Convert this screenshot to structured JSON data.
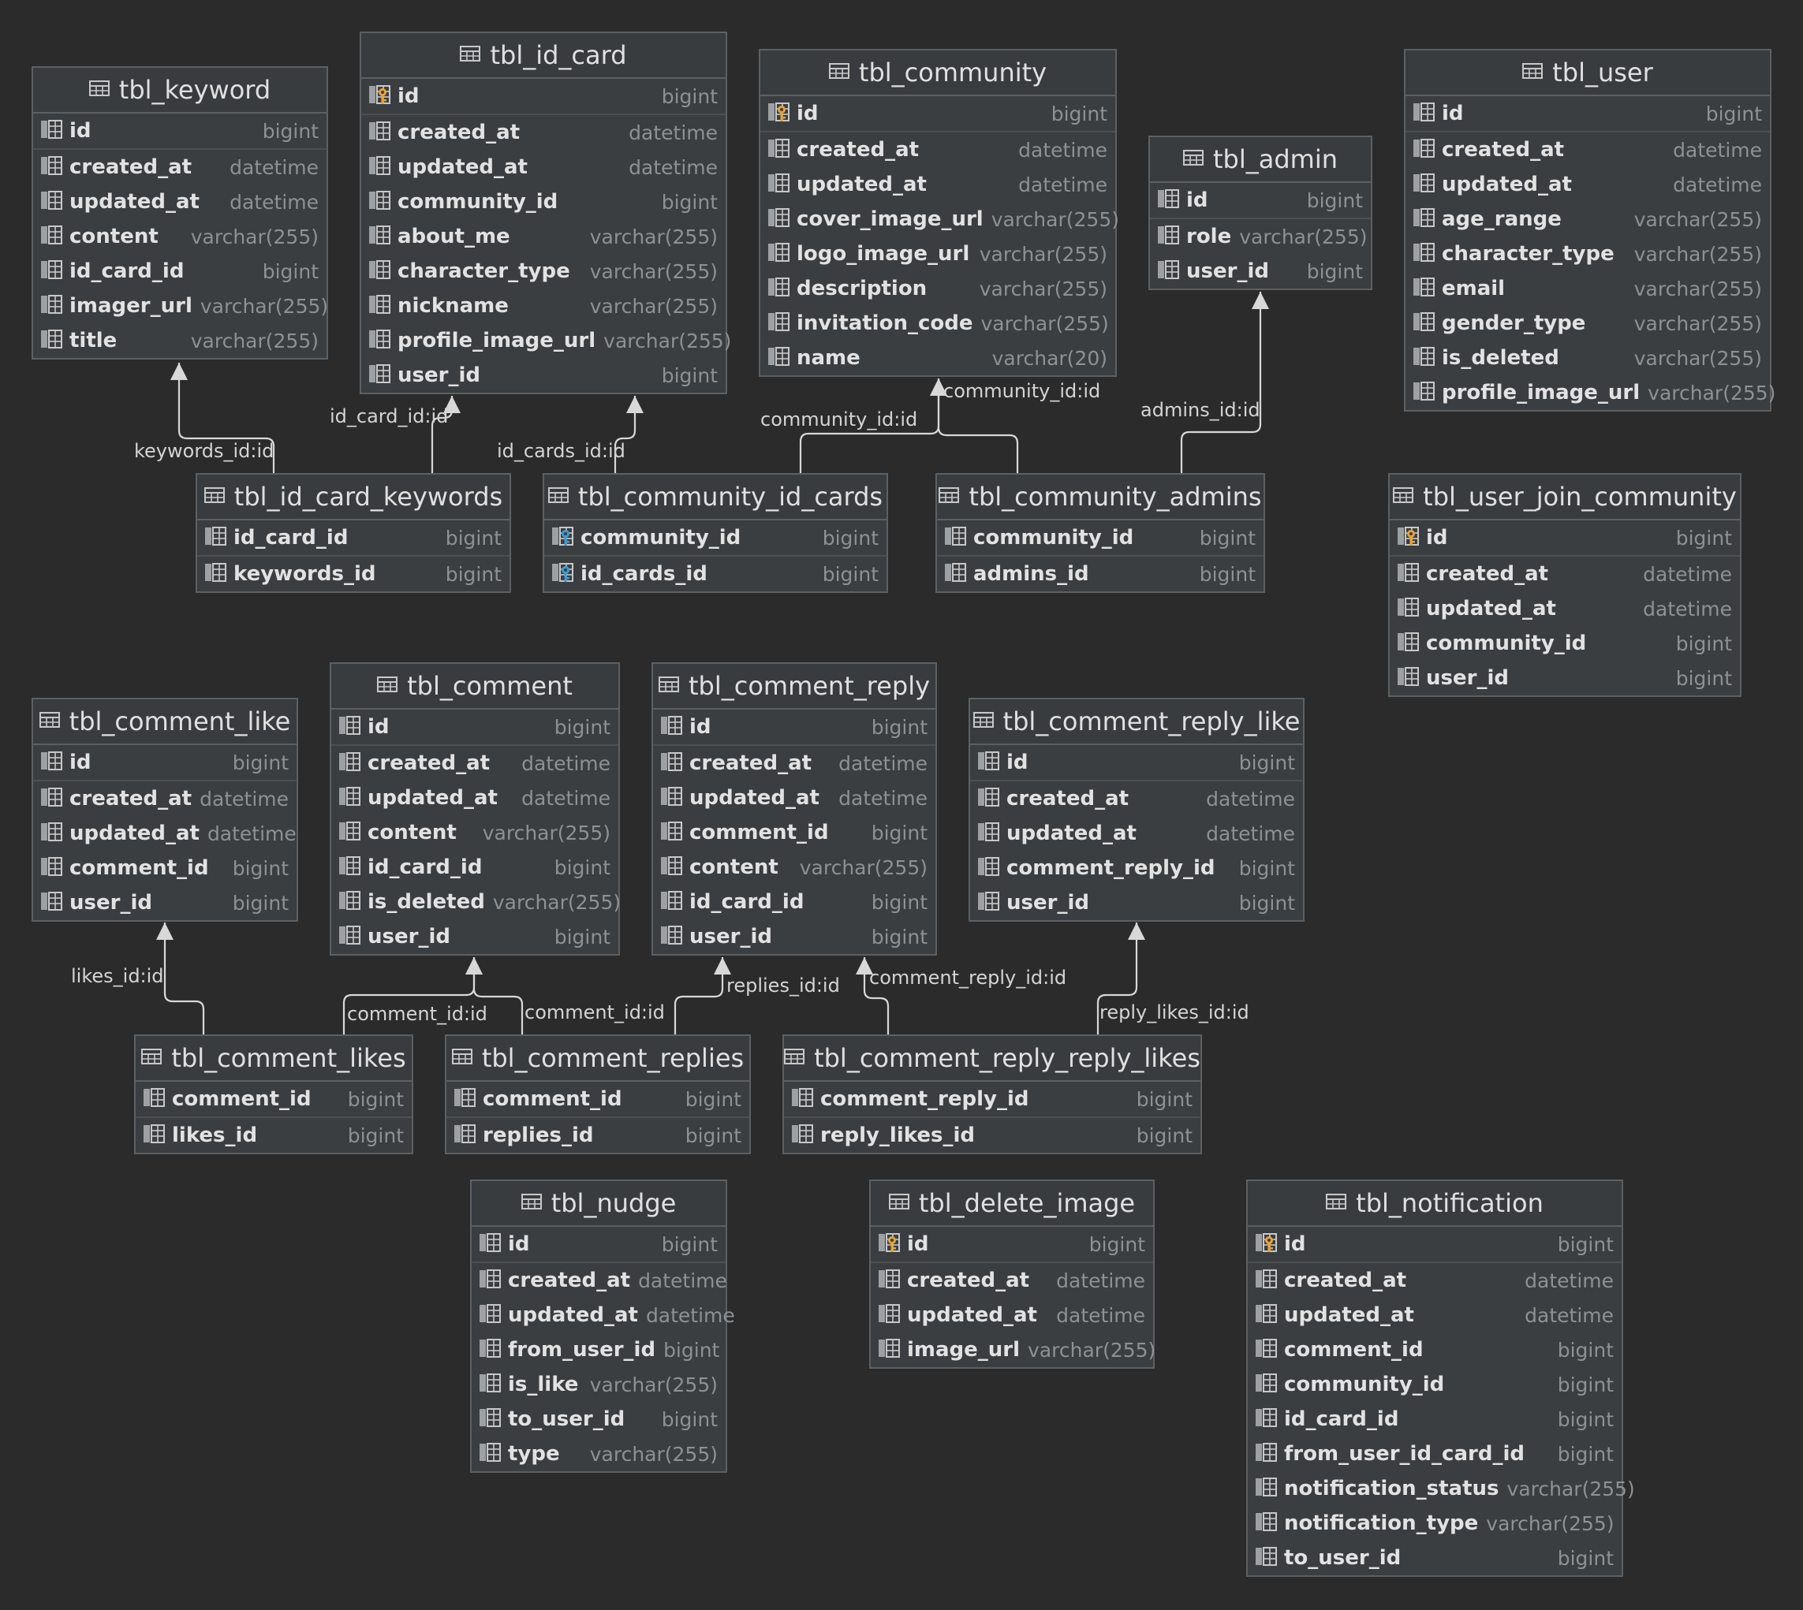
{
  "tables": [
    {
      "name": "tbl_keyword",
      "columns": [
        {
          "name": "id",
          "type": "bigint",
          "icon": "column-icon"
        },
        {
          "name": "created_at",
          "type": "datetime",
          "icon": "column-icon"
        },
        {
          "name": "updated_at",
          "type": "datetime",
          "icon": "column-icon"
        },
        {
          "name": "content",
          "type": "varchar(255)",
          "icon": "column-icon"
        },
        {
          "name": "id_card_id",
          "type": "bigint",
          "icon": "column-icon"
        },
        {
          "name": "imager_url",
          "type": "varchar(255)",
          "icon": "column-icon"
        },
        {
          "name": "title",
          "type": "varchar(255)",
          "icon": "column-icon"
        }
      ]
    },
    {
      "name": "tbl_id_card",
      "columns": [
        {
          "name": "id",
          "type": "bigint",
          "icon": "primary-key-icon"
        },
        {
          "name": "created_at",
          "type": "datetime",
          "icon": "column-icon"
        },
        {
          "name": "updated_at",
          "type": "datetime",
          "icon": "column-icon"
        },
        {
          "name": "community_id",
          "type": "bigint",
          "icon": "column-icon"
        },
        {
          "name": "about_me",
          "type": "varchar(255)",
          "icon": "column-icon"
        },
        {
          "name": "character_type",
          "type": "varchar(255)",
          "icon": "column-icon"
        },
        {
          "name": "nickname",
          "type": "varchar(255)",
          "icon": "column-icon"
        },
        {
          "name": "profile_image_url",
          "type": "varchar(255)",
          "icon": "column-icon"
        },
        {
          "name": "user_id",
          "type": "bigint",
          "icon": "column-icon"
        }
      ]
    },
    {
      "name": "tbl_community",
      "columns": [
        {
          "name": "id",
          "type": "bigint",
          "icon": "primary-key-icon"
        },
        {
          "name": "created_at",
          "type": "datetime",
          "icon": "column-icon"
        },
        {
          "name": "updated_at",
          "type": "datetime",
          "icon": "column-icon"
        },
        {
          "name": "cover_image_url",
          "type": "varchar(255)",
          "icon": "column-icon"
        },
        {
          "name": "logo_image_url",
          "type": "varchar(255)",
          "icon": "column-icon"
        },
        {
          "name": "description",
          "type": "varchar(255)",
          "icon": "column-icon"
        },
        {
          "name": "invitation_code",
          "type": "varchar(255)",
          "icon": "column-icon"
        },
        {
          "name": "name",
          "type": "varchar(20)",
          "icon": "column-icon"
        }
      ]
    },
    {
      "name": "tbl_admin",
      "columns": [
        {
          "name": "id",
          "type": "bigint",
          "icon": "column-icon"
        },
        {
          "name": "role",
          "type": "varchar(255)",
          "icon": "column-icon"
        },
        {
          "name": "user_id",
          "type": "bigint",
          "icon": "column-icon"
        }
      ]
    },
    {
      "name": "tbl_user",
      "columns": [
        {
          "name": "id",
          "type": "bigint",
          "icon": "column-icon"
        },
        {
          "name": "created_at",
          "type": "datetime",
          "icon": "column-icon"
        },
        {
          "name": "updated_at",
          "type": "datetime",
          "icon": "column-icon"
        },
        {
          "name": "age_range",
          "type": "varchar(255)",
          "icon": "column-icon"
        },
        {
          "name": "character_type",
          "type": "varchar(255)",
          "icon": "column-icon"
        },
        {
          "name": "email",
          "type": "varchar(255)",
          "icon": "column-icon"
        },
        {
          "name": "gender_type",
          "type": "varchar(255)",
          "icon": "column-icon"
        },
        {
          "name": "is_deleted",
          "type": "varchar(255)",
          "icon": "column-icon"
        },
        {
          "name": "profile_image_url",
          "type": "varchar(255)",
          "icon": "column-icon"
        }
      ]
    },
    {
      "name": "tbl_id_card_keywords",
      "columns": [
        {
          "name": "id_card_id",
          "type": "bigint",
          "icon": "column-icon"
        },
        {
          "name": "keywords_id",
          "type": "bigint",
          "icon": "column-icon"
        }
      ]
    },
    {
      "name": "tbl_community_id_cards",
      "columns": [
        {
          "name": "community_id",
          "type": "bigint",
          "icon": "composite-key-icon"
        },
        {
          "name": "id_cards_id",
          "type": "bigint",
          "icon": "composite-key-icon"
        }
      ]
    },
    {
      "name": "tbl_community_admins",
      "columns": [
        {
          "name": "community_id",
          "type": "bigint",
          "icon": "column-icon"
        },
        {
          "name": "admins_id",
          "type": "bigint",
          "icon": "column-icon"
        }
      ]
    },
    {
      "name": "tbl_user_join_community",
      "columns": [
        {
          "name": "id",
          "type": "bigint",
          "icon": "primary-key-icon"
        },
        {
          "name": "created_at",
          "type": "datetime",
          "icon": "column-icon"
        },
        {
          "name": "updated_at",
          "type": "datetime",
          "icon": "column-icon"
        },
        {
          "name": "community_id",
          "type": "bigint",
          "icon": "column-icon"
        },
        {
          "name": "user_id",
          "type": "bigint",
          "icon": "column-icon"
        }
      ]
    },
    {
      "name": "tbl_comment_like",
      "columns": [
        {
          "name": "id",
          "type": "bigint",
          "icon": "column-icon"
        },
        {
          "name": "created_at",
          "type": "datetime",
          "icon": "column-icon"
        },
        {
          "name": "updated_at",
          "type": "datetime",
          "icon": "column-icon"
        },
        {
          "name": "comment_id",
          "type": "bigint",
          "icon": "column-icon"
        },
        {
          "name": "user_id",
          "type": "bigint",
          "icon": "column-icon"
        }
      ]
    },
    {
      "name": "tbl_comment",
      "columns": [
        {
          "name": "id",
          "type": "bigint",
          "icon": "column-icon"
        },
        {
          "name": "created_at",
          "type": "datetime",
          "icon": "column-icon"
        },
        {
          "name": "updated_at",
          "type": "datetime",
          "icon": "column-icon"
        },
        {
          "name": "content",
          "type": "varchar(255)",
          "icon": "column-icon"
        },
        {
          "name": "id_card_id",
          "type": "bigint",
          "icon": "column-icon"
        },
        {
          "name": "is_deleted",
          "type": "varchar(255)",
          "icon": "column-icon"
        },
        {
          "name": "user_id",
          "type": "bigint",
          "icon": "column-icon"
        }
      ]
    },
    {
      "name": "tbl_comment_reply",
      "columns": [
        {
          "name": "id",
          "type": "bigint",
          "icon": "column-icon"
        },
        {
          "name": "created_at",
          "type": "datetime",
          "icon": "column-icon"
        },
        {
          "name": "updated_at",
          "type": "datetime",
          "icon": "column-icon"
        },
        {
          "name": "comment_id",
          "type": "bigint",
          "icon": "column-icon"
        },
        {
          "name": "content",
          "type": "varchar(255)",
          "icon": "column-icon"
        },
        {
          "name": "id_card_id",
          "type": "bigint",
          "icon": "column-icon"
        },
        {
          "name": "user_id",
          "type": "bigint",
          "icon": "column-icon"
        }
      ]
    },
    {
      "name": "tbl_comment_reply_like",
      "columns": [
        {
          "name": "id",
          "type": "bigint",
          "icon": "column-icon"
        },
        {
          "name": "created_at",
          "type": "datetime",
          "icon": "column-icon"
        },
        {
          "name": "updated_at",
          "type": "datetime",
          "icon": "column-icon"
        },
        {
          "name": "comment_reply_id",
          "type": "bigint",
          "icon": "column-icon"
        },
        {
          "name": "user_id",
          "type": "bigint",
          "icon": "column-icon"
        }
      ]
    },
    {
      "name": "tbl_comment_likes",
      "columns": [
        {
          "name": "comment_id",
          "type": "bigint",
          "icon": "column-icon"
        },
        {
          "name": "likes_id",
          "type": "bigint",
          "icon": "column-icon"
        }
      ]
    },
    {
      "name": "tbl_comment_replies",
      "columns": [
        {
          "name": "comment_id",
          "type": "bigint",
          "icon": "column-icon"
        },
        {
          "name": "replies_id",
          "type": "bigint",
          "icon": "column-icon"
        }
      ]
    },
    {
      "name": "tbl_comment_reply_reply_likes",
      "columns": [
        {
          "name": "comment_reply_id",
          "type": "bigint",
          "icon": "column-icon"
        },
        {
          "name": "reply_likes_id",
          "type": "bigint",
          "icon": "column-icon"
        }
      ]
    },
    {
      "name": "tbl_nudge",
      "columns": [
        {
          "name": "id",
          "type": "bigint",
          "icon": "column-icon"
        },
        {
          "name": "created_at",
          "type": "datetime",
          "icon": "column-icon"
        },
        {
          "name": "updated_at",
          "type": "datetime",
          "icon": "column-icon"
        },
        {
          "name": "from_user_id",
          "type": "bigint",
          "icon": "column-icon"
        },
        {
          "name": "is_like",
          "type": "varchar(255)",
          "icon": "column-icon"
        },
        {
          "name": "to_user_id",
          "type": "bigint",
          "icon": "column-icon"
        },
        {
          "name": "type",
          "type": "varchar(255)",
          "icon": "column-icon"
        }
      ]
    },
    {
      "name": "tbl_delete_image",
      "columns": [
        {
          "name": "id",
          "type": "bigint",
          "icon": "primary-key-icon"
        },
        {
          "name": "created_at",
          "type": "datetime",
          "icon": "column-icon"
        },
        {
          "name": "updated_at",
          "type": "datetime",
          "icon": "column-icon"
        },
        {
          "name": "image_url",
          "type": "varchar(255)",
          "icon": "column-icon"
        }
      ]
    },
    {
      "name": "tbl_notification",
      "columns": [
        {
          "name": "id",
          "type": "bigint",
          "icon": "primary-key-icon"
        },
        {
          "name": "created_at",
          "type": "datetime",
          "icon": "column-icon"
        },
        {
          "name": "updated_at",
          "type": "datetime",
          "icon": "column-icon"
        },
        {
          "name": "comment_id",
          "type": "bigint",
          "icon": "column-icon"
        },
        {
          "name": "community_id",
          "type": "bigint",
          "icon": "column-icon"
        },
        {
          "name": "id_card_id",
          "type": "bigint",
          "icon": "column-icon"
        },
        {
          "name": "from_user_id_card_id",
          "type": "bigint",
          "icon": "column-icon"
        },
        {
          "name": "notification_status",
          "type": "varchar(255)",
          "icon": "column-icon"
        },
        {
          "name": "notification_type",
          "type": "varchar(255)",
          "icon": "column-icon"
        },
        {
          "name": "to_user_id",
          "type": "bigint",
          "icon": "column-icon"
        }
      ]
    }
  ],
  "relationships": [
    {
      "from": "tbl_id_card_keywords",
      "to": "tbl_keyword",
      "label": "keywords_id:id"
    },
    {
      "from": "tbl_id_card_keywords",
      "to": "tbl_id_card",
      "label": "id_card_id:id"
    },
    {
      "from": "tbl_community_id_cards",
      "to": "tbl_id_card",
      "label": "id_cards_id:id"
    },
    {
      "from": "tbl_community_id_cards",
      "to": "tbl_community",
      "label": "community_id:id"
    },
    {
      "from": "tbl_community_admins",
      "to": "tbl_community",
      "label": "community_id:id"
    },
    {
      "from": "tbl_community_admins",
      "to": "tbl_admin",
      "label": "admins_id:id"
    },
    {
      "from": "tbl_comment_likes",
      "to": "tbl_comment_like",
      "label": "likes_id:id"
    },
    {
      "from": "tbl_comment_likes",
      "to": "tbl_comment",
      "label": "comment_id:id"
    },
    {
      "from": "tbl_comment_replies",
      "to": "tbl_comment",
      "label": "comment_id:id"
    },
    {
      "from": "tbl_comment_replies",
      "to": "tbl_comment_reply",
      "label": "replies_id:id"
    },
    {
      "from": "tbl_comment_reply_reply_likes",
      "to": "tbl_comment_reply",
      "label": "comment_reply_id:id"
    },
    {
      "from": "tbl_comment_reply_reply_likes",
      "to": "tbl_comment_reply_like",
      "label": "reply_likes_id:id"
    }
  ],
  "colors": {
    "background": "#2b2b2b",
    "table_fill": "#3b3e41",
    "table_border": "#5d6063",
    "text": "#e2e2e2",
    "type_text": "#8e9194",
    "primary_key": "#e7a437",
    "composite_key": "#3d9ad6",
    "connector": "#d8d8d8"
  }
}
